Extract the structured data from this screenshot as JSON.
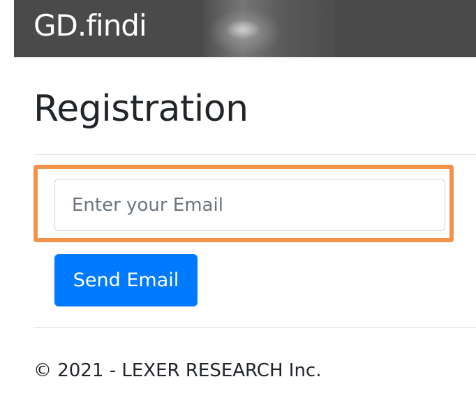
{
  "header": {
    "brand": "GD.findi"
  },
  "main": {
    "title": "Registration",
    "email_input": {
      "placeholder": "Enter your Email",
      "value": ""
    },
    "send_button_label": "Send Email"
  },
  "footer": {
    "text": "© 2021 - LEXER RESEARCH Inc."
  },
  "colors": {
    "header_bg": "#4a4a4a",
    "primary_button": "#007bff",
    "highlight_border": "#f4924a"
  }
}
